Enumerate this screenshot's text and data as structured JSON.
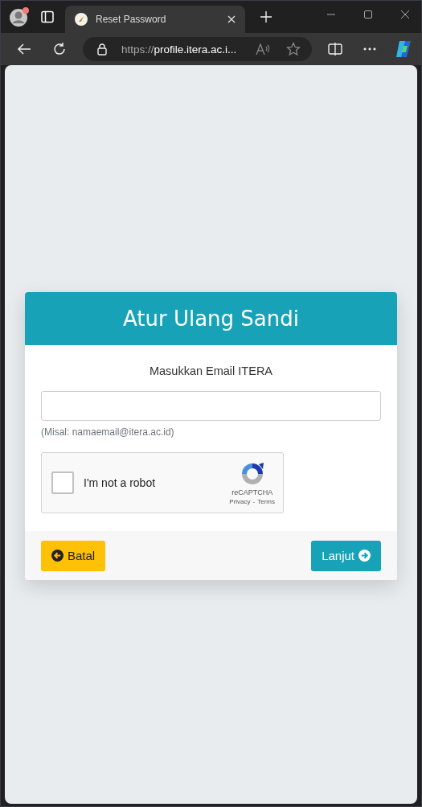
{
  "browser": {
    "tab_title": "Reset Password",
    "url_scheme": "https://",
    "url_host": "profile.itera.ac.i..."
  },
  "card": {
    "title": "Atur Ulang Sandi",
    "label": "Masukkan Email ITERA",
    "hint": "(Misal: namaemail@itera.ac.id)",
    "captcha": {
      "label": "I'm not a robot",
      "checked": false,
      "brand": "reCAPTCHA",
      "privacy": "Privacy",
      "separator": "-",
      "terms": "Terms"
    },
    "buttons": [
      {
        "kind": "back",
        "label": "Batal"
      },
      {
        "kind": "next",
        "label": "Lanjut"
      }
    ]
  }
}
